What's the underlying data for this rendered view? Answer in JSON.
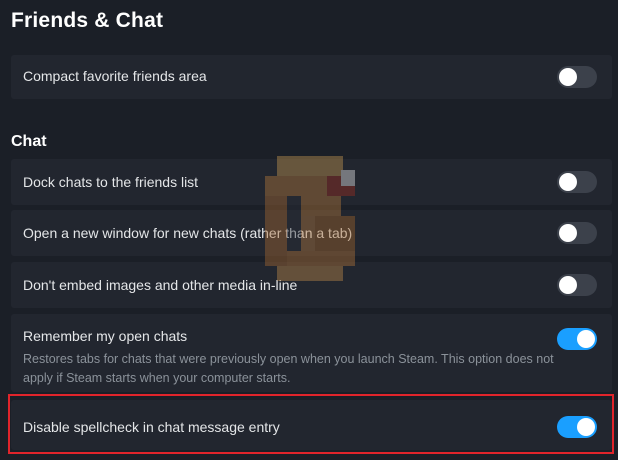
{
  "page": {
    "title": "Friends & Chat"
  },
  "friends": {
    "items": [
      {
        "label": "Compact favorite friends area",
        "enabled": false
      }
    ]
  },
  "chat": {
    "heading": "Chat",
    "items": [
      {
        "label": "Dock chats to the friends list",
        "enabled": false
      },
      {
        "label": "Open a new window for new chats (rather than a tab)",
        "enabled": false
      },
      {
        "label": "Don't embed images and other media in-line",
        "enabled": false
      },
      {
        "label": "Remember my open chats",
        "description": "Restores tabs for chats that were previously open when you launch Steam. This option does not apply if Steam starts when your computer starts.",
        "enabled": true
      },
      {
        "label": "Disable spellcheck in chat message entry",
        "enabled": true
      }
    ]
  },
  "colors": {
    "background": "#1b1f27",
    "row": "#22262f",
    "toggle_on": "#1a9fff",
    "toggle_off": "#3c414b",
    "highlight": "#e0242b"
  }
}
